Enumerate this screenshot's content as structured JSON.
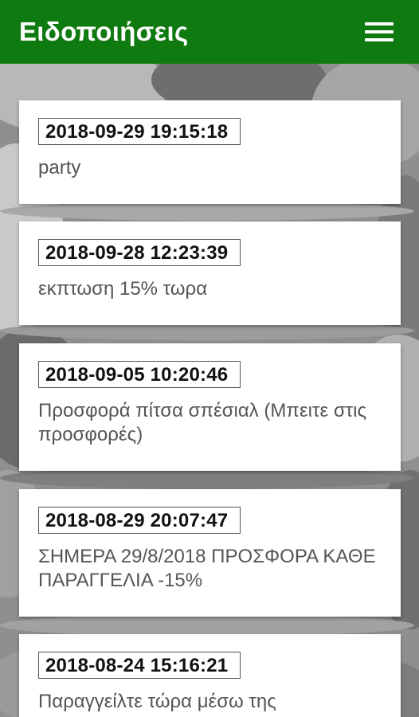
{
  "header": {
    "title": "Ειδοποιήσεις",
    "menu_icon": "hamburger-menu-icon"
  },
  "notifications": [
    {
      "date": "2018-09-29 19:15:18",
      "text": "party"
    },
    {
      "date": "2018-09-28 12:23:39",
      "text": "εκπτωση 15% τωρα"
    },
    {
      "date": "2018-09-05 10:20:46",
      "text": "Προσφορά πίτσα σπέσιαλ (Μπειτε στις προσφορές)"
    },
    {
      "date": "2018-08-29 20:07:47",
      "text": "ΣΗΜΕΡΑ 29/8/2018 ΠΡΟΣΦΟΡΑ ΚΑΘΕ ΠΑΡΑΓΓΕΛΙΑ -15%"
    },
    {
      "date": "2018-08-24 15:16:21",
      "text": "Παραγγείλτε τώρα μέσω της"
    }
  ],
  "colors": {
    "app_bar": "#0f7a0f",
    "card_background": "#ffffff",
    "date_text": "#111111",
    "body_text": "#555555"
  }
}
